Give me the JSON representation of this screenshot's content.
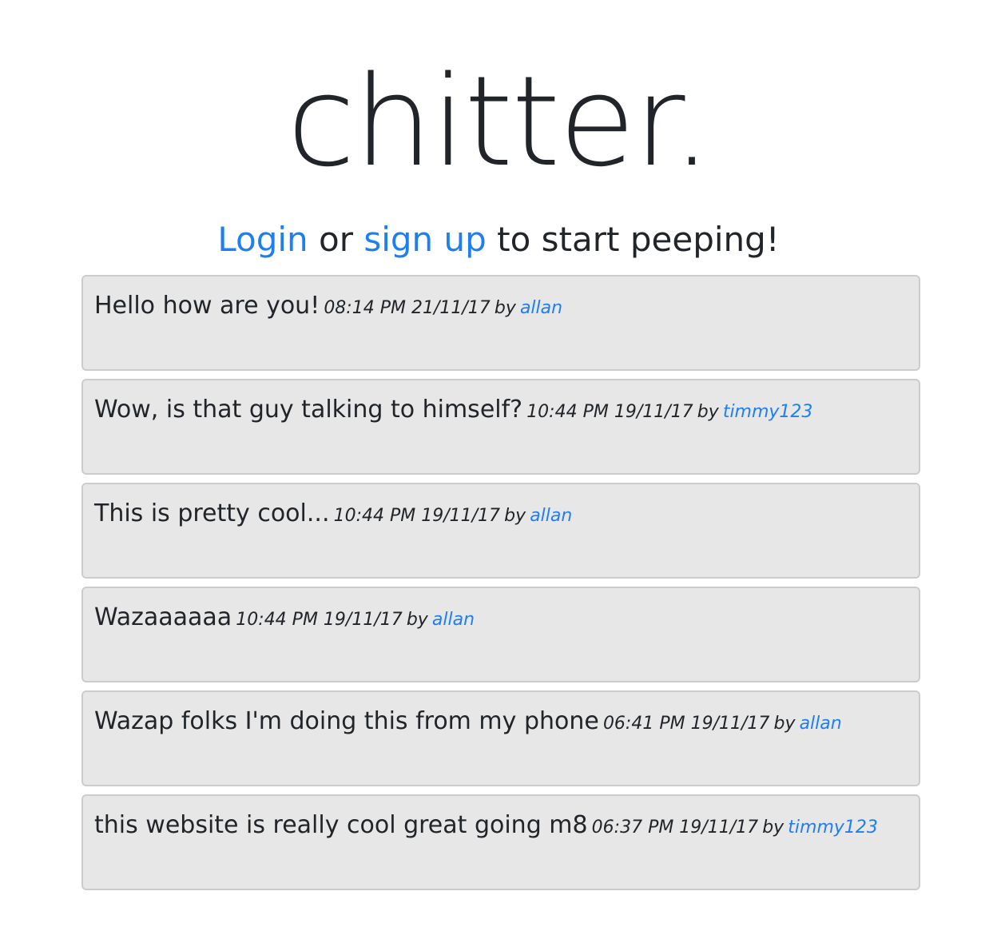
{
  "header": {
    "brand": "chitter."
  },
  "tagline": {
    "login_link": "Login",
    "or_text": " or ",
    "signup_link": "sign up",
    "rest_text": " to start peeping!"
  },
  "peeps": [
    {
      "text": "Hello how are you!",
      "time": "08:14 PM 21/11/17",
      "by": "by",
      "author": "allan"
    },
    {
      "text": "Wow, is that guy talking to himself?",
      "time": "10:44 PM 19/11/17",
      "by": "by",
      "author": "timmy123"
    },
    {
      "text": "This is pretty cool...",
      "time": "10:44 PM 19/11/17",
      "by": "by",
      "author": "allan"
    },
    {
      "text": "Wazaaaaaa",
      "time": "10:44 PM 19/11/17",
      "by": "by",
      "author": "allan"
    },
    {
      "text": "Wazap folks I'm doing this from my phone",
      "time": "06:41 PM 19/11/17",
      "by": "by",
      "author": "allan"
    },
    {
      "text": "this website is really cool great going m8",
      "time": "06:37 PM 19/11/17",
      "by": "by",
      "author": "timmy123"
    }
  ],
  "colors": {
    "link": "#1e7ff0",
    "text": "#212529",
    "peep_background": "#e7e7e7",
    "peep_border": "#cccccc"
  }
}
